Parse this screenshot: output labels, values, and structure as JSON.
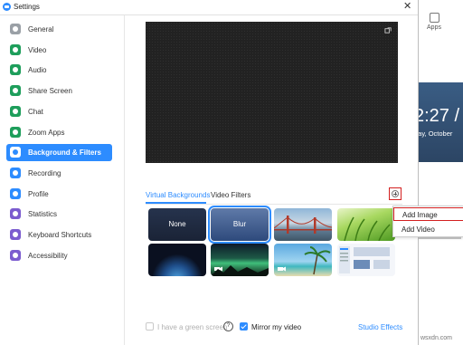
{
  "window": {
    "title": "Settings",
    "close_glyph": "✕"
  },
  "background_app": {
    "apps_label": "Apps",
    "time": "2:27 /",
    "date": "day, October"
  },
  "sidebar": {
    "items": [
      {
        "label": "General",
        "icon": "gear-icon",
        "color": "#9aa0a6"
      },
      {
        "label": "Video",
        "icon": "video-icon",
        "color": "#1e9e5b"
      },
      {
        "label": "Audio",
        "icon": "headphones-icon",
        "color": "#1e9e5b"
      },
      {
        "label": "Share Screen",
        "icon": "share-screen-icon",
        "color": "#1e9e5b"
      },
      {
        "label": "Chat",
        "icon": "chat-icon",
        "color": "#1e9e5b"
      },
      {
        "label": "Zoom Apps",
        "icon": "zoom-apps-icon",
        "color": "#1e9e5b"
      },
      {
        "label": "Background & Filters",
        "icon": "background-icon",
        "color": "#2d8cff",
        "active": true
      },
      {
        "label": "Recording",
        "icon": "recording-icon",
        "color": "#2d8cff"
      },
      {
        "label": "Profile",
        "icon": "profile-icon",
        "color": "#2d8cff"
      },
      {
        "label": "Statistics",
        "icon": "statistics-icon",
        "color": "#7b5ccf"
      },
      {
        "label": "Keyboard Shortcuts",
        "icon": "keyboard-icon",
        "color": "#7b5ccf"
      },
      {
        "label": "Accessibility",
        "icon": "accessibility-icon",
        "color": "#7b5ccf"
      }
    ]
  },
  "tabs": {
    "virtual_backgrounds": "Virtual Backgrounds",
    "video_filters": "Video Filters"
  },
  "add_menu": {
    "add_image": "Add Image",
    "add_video": "Add Video"
  },
  "thumbnails": [
    {
      "label": "None",
      "kind": "none"
    },
    {
      "label": "Blur",
      "kind": "blur",
      "selected": true
    },
    {
      "label": "",
      "kind": "golden-gate-bridge"
    },
    {
      "label": "",
      "kind": "grass"
    },
    {
      "label": "",
      "kind": "earth-from-space"
    },
    {
      "label": "",
      "kind": "aurora"
    },
    {
      "label": "",
      "kind": "beach"
    },
    {
      "label": "",
      "kind": "custom-screenshot"
    }
  ],
  "footer": {
    "green_screen": "I have a green screen",
    "help_glyph": "?",
    "mirror": "Mirror my video",
    "studio_effects": "Studio Effects"
  },
  "watermark": "wsxdn.com",
  "colors": {
    "accent": "#2d8cff",
    "highlight": "#d32020"
  }
}
